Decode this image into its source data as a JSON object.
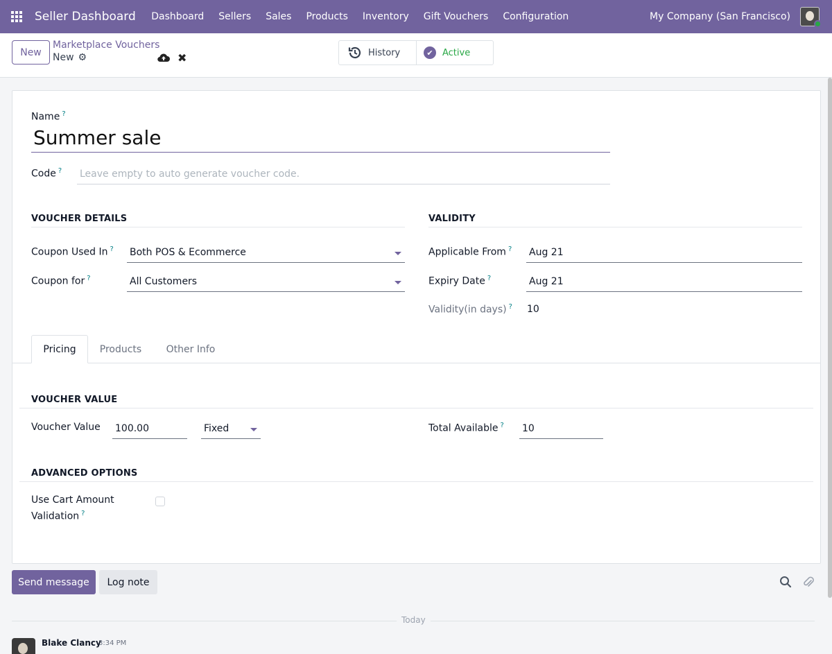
{
  "navbar": {
    "brand": "Seller Dashboard",
    "menu": [
      "Dashboard",
      "Sellers",
      "Sales",
      "Products",
      "Inventory",
      "Gift Vouchers",
      "Configuration"
    ],
    "company": "My Company (San Francisco)"
  },
  "control_panel": {
    "new_label": "New",
    "breadcrumb": "Marketplace Vouchers",
    "record_name": "New",
    "history_label": "History",
    "active_label": "Active"
  },
  "form": {
    "name_label": "Name",
    "name_value": "Summer sale",
    "code_label": "Code",
    "code_placeholder": "Leave empty to auto generate voucher code.",
    "voucher_details_title": "VOUCHER DETAILS",
    "coupon_used_in_label": "Coupon Used In",
    "coupon_used_in_value": "Both POS & Ecommerce",
    "coupon_for_label": "Coupon for",
    "coupon_for_value": "All Customers",
    "validity_title": "VALIDITY",
    "applicable_from_label": "Applicable From",
    "applicable_from_value": "Aug 21",
    "expiry_date_label": "Expiry Date",
    "expiry_date_value": "Aug 21",
    "validity_days_label": "Validity(in days)",
    "validity_days_value": "10"
  },
  "tabs": [
    "Pricing",
    "Products",
    "Other Info"
  ],
  "pricing": {
    "voucher_value_title": "VOUCHER VALUE",
    "voucher_value_label": "Voucher Value",
    "voucher_value_amount": "100.00",
    "voucher_value_type": "Fixed",
    "total_available_label": "Total Available",
    "total_available_value": "10",
    "advanced_title": "ADVANCED OPTIONS",
    "cart_validation_label_1": "Use Cart Amount",
    "cart_validation_label_2": "Validation",
    "cart_validation_checked": false
  },
  "chatter": {
    "send_label": "Send message",
    "log_label": "Log note",
    "today_label": "Today",
    "author": "Blake Clancy",
    "time": "3:34 PM"
  },
  "colors": {
    "brand": "#71639e",
    "active": "#28a745",
    "help": "#017e84"
  }
}
